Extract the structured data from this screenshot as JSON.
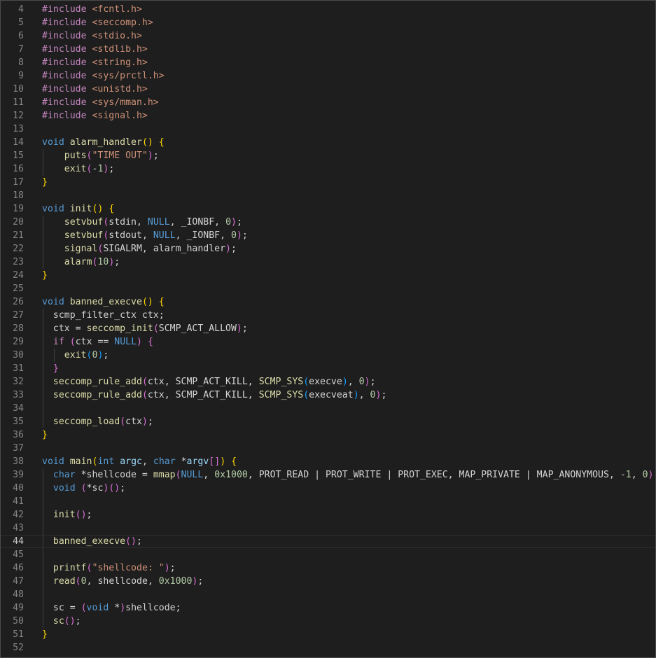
{
  "editor": {
    "language": "c",
    "lines": [
      {
        "n": "4",
        "indent": [],
        "tokens": [
          [
            "#include ",
            "pp"
          ],
          [
            "<fcntl.h>",
            "str"
          ]
        ]
      },
      {
        "n": "5",
        "indent": [],
        "tokens": [
          [
            "#include ",
            "pp"
          ],
          [
            "<seccomp.h>",
            "str"
          ]
        ]
      },
      {
        "n": "6",
        "indent": [],
        "tokens": [
          [
            "#include ",
            "pp"
          ],
          [
            "<stdio.h>",
            "str"
          ]
        ]
      },
      {
        "n": "7",
        "indent": [],
        "tokens": [
          [
            "#include ",
            "pp"
          ],
          [
            "<stdlib.h>",
            "str"
          ]
        ]
      },
      {
        "n": "8",
        "indent": [],
        "tokens": [
          [
            "#include ",
            "pp"
          ],
          [
            "<string.h>",
            "str"
          ]
        ]
      },
      {
        "n": "9",
        "indent": [],
        "tokens": [
          [
            "#include ",
            "pp"
          ],
          [
            "<sys/prctl.h>",
            "str"
          ]
        ]
      },
      {
        "n": "10",
        "indent": [],
        "tokens": [
          [
            "#include ",
            "pp"
          ],
          [
            "<unistd.h>",
            "str"
          ]
        ]
      },
      {
        "n": "11",
        "indent": [],
        "tokens": [
          [
            "#include ",
            "pp"
          ],
          [
            "<sys/mman.h>",
            "str"
          ]
        ]
      },
      {
        "n": "12",
        "indent": [],
        "tokens": [
          [
            "#include ",
            "pp"
          ],
          [
            "<signal.h>",
            "str"
          ]
        ]
      },
      {
        "n": "13",
        "indent": [],
        "tokens": []
      },
      {
        "n": "14",
        "indent": [],
        "tokens": [
          [
            "void",
            "kw"
          ],
          [
            " ",
            "def"
          ],
          [
            "alarm_handler",
            "fn"
          ],
          [
            "()",
            "b1"
          ],
          [
            " ",
            "def"
          ],
          [
            "{",
            "b1"
          ]
        ]
      },
      {
        "n": "15",
        "indent": [
          0
        ],
        "tokens": [
          [
            "    ",
            "def"
          ],
          [
            "puts",
            "fn"
          ],
          [
            "(",
            "b2"
          ],
          [
            "\"TIME OUT\"",
            "str"
          ],
          [
            ")",
            "b2"
          ],
          [
            ";",
            "def"
          ]
        ]
      },
      {
        "n": "16",
        "indent": [
          0
        ],
        "tokens": [
          [
            "    ",
            "def"
          ],
          [
            "exit",
            "fn"
          ],
          [
            "(",
            "b2"
          ],
          [
            "-",
            "def"
          ],
          [
            "1",
            "num"
          ],
          [
            ")",
            "b2"
          ],
          [
            ";",
            "def"
          ]
        ]
      },
      {
        "n": "17",
        "indent": [],
        "tokens": [
          [
            "}",
            "b1"
          ]
        ]
      },
      {
        "n": "18",
        "indent": [],
        "tokens": []
      },
      {
        "n": "19",
        "indent": [],
        "tokens": [
          [
            "void",
            "kw"
          ],
          [
            " ",
            "def"
          ],
          [
            "init",
            "fn"
          ],
          [
            "()",
            "b1"
          ],
          [
            " ",
            "def"
          ],
          [
            "{",
            "b1"
          ]
        ]
      },
      {
        "n": "20",
        "indent": [
          0
        ],
        "tokens": [
          [
            "    ",
            "def"
          ],
          [
            "setvbuf",
            "fn"
          ],
          [
            "(",
            "b2"
          ],
          [
            "stdin",
            "def"
          ],
          [
            ", ",
            "def"
          ],
          [
            "NULL",
            "const"
          ],
          [
            ", _IONBF, ",
            "def"
          ],
          [
            "0",
            "num"
          ],
          [
            ")",
            "b2"
          ],
          [
            ";",
            "def"
          ]
        ]
      },
      {
        "n": "21",
        "indent": [
          0
        ],
        "tokens": [
          [
            "    ",
            "def"
          ],
          [
            "setvbuf",
            "fn"
          ],
          [
            "(",
            "b2"
          ],
          [
            "stdout",
            "def"
          ],
          [
            ", ",
            "def"
          ],
          [
            "NULL",
            "const"
          ],
          [
            ", _IONBF, ",
            "def"
          ],
          [
            "0",
            "num"
          ],
          [
            ")",
            "b2"
          ],
          [
            ";",
            "def"
          ]
        ]
      },
      {
        "n": "22",
        "indent": [
          0
        ],
        "tokens": [
          [
            "    ",
            "def"
          ],
          [
            "signal",
            "fn"
          ],
          [
            "(",
            "b2"
          ],
          [
            "SIGALRM, alarm_handler",
            "def"
          ],
          [
            ")",
            "b2"
          ],
          [
            ";",
            "def"
          ]
        ]
      },
      {
        "n": "23",
        "indent": [
          0
        ],
        "tokens": [
          [
            "    ",
            "def"
          ],
          [
            "alarm",
            "fn"
          ],
          [
            "(",
            "b2"
          ],
          [
            "10",
            "num"
          ],
          [
            ")",
            "b2"
          ],
          [
            ";",
            "def"
          ]
        ]
      },
      {
        "n": "24",
        "indent": [],
        "tokens": [
          [
            "}",
            "b1"
          ]
        ]
      },
      {
        "n": "25",
        "indent": [],
        "tokens": []
      },
      {
        "n": "26",
        "indent": [],
        "tokens": [
          [
            "void",
            "kw"
          ],
          [
            " ",
            "def"
          ],
          [
            "banned_execve",
            "fn"
          ],
          [
            "()",
            "b1"
          ],
          [
            " ",
            "def"
          ],
          [
            "{",
            "b1"
          ]
        ]
      },
      {
        "n": "27",
        "indent": [
          0
        ],
        "tokens": [
          [
            "  ",
            "def"
          ],
          [
            "scmp_filter_ctx ctx",
            "def"
          ],
          [
            ";",
            "def"
          ]
        ]
      },
      {
        "n": "28",
        "indent": [
          0
        ],
        "tokens": [
          [
            "  ctx = ",
            "def"
          ],
          [
            "seccomp_init",
            "fn"
          ],
          [
            "(",
            "b2"
          ],
          [
            "SCMP_ACT_ALLOW",
            "def"
          ],
          [
            ")",
            "b2"
          ],
          [
            ";",
            "def"
          ]
        ]
      },
      {
        "n": "29",
        "indent": [
          0
        ],
        "tokens": [
          [
            "  ",
            "def"
          ],
          [
            "if",
            "ctl"
          ],
          [
            " ",
            "def"
          ],
          [
            "(",
            "b2"
          ],
          [
            "ctx == ",
            "def"
          ],
          [
            "NULL",
            "const"
          ],
          [
            ")",
            "b2"
          ],
          [
            " ",
            "def"
          ],
          [
            "{",
            "b2"
          ]
        ]
      },
      {
        "n": "30",
        "indent": [
          0,
          1
        ],
        "tokens": [
          [
            "    ",
            "def"
          ],
          [
            "exit",
            "fn"
          ],
          [
            "(",
            "b3"
          ],
          [
            "0",
            "num"
          ],
          [
            ")",
            "b3"
          ],
          [
            ";",
            "def"
          ]
        ]
      },
      {
        "n": "31",
        "indent": [
          0
        ],
        "tokens": [
          [
            "  ",
            "def"
          ],
          [
            "}",
            "b2"
          ]
        ]
      },
      {
        "n": "32",
        "indent": [
          0
        ],
        "tokens": [
          [
            "  ",
            "def"
          ],
          [
            "seccomp_rule_add",
            "fn"
          ],
          [
            "(",
            "b2"
          ],
          [
            "ctx, SCMP_ACT_KILL, ",
            "def"
          ],
          [
            "SCMP_SYS",
            "fn"
          ],
          [
            "(",
            "b3"
          ],
          [
            "execve",
            "def"
          ],
          [
            ")",
            "b3"
          ],
          [
            ", ",
            "def"
          ],
          [
            "0",
            "num"
          ],
          [
            ")",
            "b2"
          ],
          [
            ";",
            "def"
          ]
        ]
      },
      {
        "n": "33",
        "indent": [
          0
        ],
        "tokens": [
          [
            "  ",
            "def"
          ],
          [
            "seccomp_rule_add",
            "fn"
          ],
          [
            "(",
            "b2"
          ],
          [
            "ctx, SCMP_ACT_KILL, ",
            "def"
          ],
          [
            "SCMP_SYS",
            "fn"
          ],
          [
            "(",
            "b3"
          ],
          [
            "execveat",
            "def"
          ],
          [
            ")",
            "b3"
          ],
          [
            ", ",
            "def"
          ],
          [
            "0",
            "num"
          ],
          [
            ")",
            "b2"
          ],
          [
            ";",
            "def"
          ]
        ]
      },
      {
        "n": "34",
        "indent": [
          0
        ],
        "tokens": []
      },
      {
        "n": "35",
        "indent": [
          0
        ],
        "tokens": [
          [
            "  ",
            "def"
          ],
          [
            "seccomp_load",
            "fn"
          ],
          [
            "(",
            "b2"
          ],
          [
            "ctx",
            "def"
          ],
          [
            ")",
            "b2"
          ],
          [
            ";",
            "def"
          ]
        ]
      },
      {
        "n": "36",
        "indent": [],
        "tokens": [
          [
            "}",
            "b1"
          ]
        ]
      },
      {
        "n": "37",
        "indent": [],
        "tokens": []
      },
      {
        "n": "38",
        "indent": [],
        "tokens": [
          [
            "void",
            "kw"
          ],
          [
            " ",
            "def"
          ],
          [
            "main",
            "fn"
          ],
          [
            "(",
            "b1"
          ],
          [
            "int",
            "kw"
          ],
          [
            " ",
            "def"
          ],
          [
            "argc",
            "var"
          ],
          [
            ", ",
            "def"
          ],
          [
            "char",
            "kw"
          ],
          [
            " *",
            "def"
          ],
          [
            "argv",
            "var"
          ],
          [
            "[]",
            "b2"
          ],
          [
            ")",
            "b1"
          ],
          [
            " ",
            "def"
          ],
          [
            "{",
            "b1"
          ]
        ]
      },
      {
        "n": "39",
        "indent": [
          0
        ],
        "tokens": [
          [
            "  ",
            "def"
          ],
          [
            "char",
            "kw"
          ],
          [
            " *shellcode = ",
            "def"
          ],
          [
            "mmap",
            "fn"
          ],
          [
            "(",
            "b2"
          ],
          [
            "NULL",
            "const"
          ],
          [
            ", ",
            "def"
          ],
          [
            "0x1000",
            "num"
          ],
          [
            ", PROT_READ | PROT_WRITE | PROT_EXEC, MAP_PRIVATE | MAP_ANONYMOUS, ",
            "def"
          ],
          [
            "-",
            "def"
          ],
          [
            "1",
            "num"
          ],
          [
            ", ",
            "def"
          ],
          [
            "0",
            "num"
          ],
          [
            ")",
            "b2"
          ],
          [
            ";",
            "def"
          ]
        ]
      },
      {
        "n": "40",
        "indent": [
          0
        ],
        "tokens": [
          [
            "  ",
            "def"
          ],
          [
            "void",
            "kw"
          ],
          [
            " ",
            "def"
          ],
          [
            "(",
            "b2"
          ],
          [
            "*sc",
            "def"
          ],
          [
            ")",
            "b2"
          ],
          [
            "()",
            "b2"
          ],
          [
            ";",
            "def"
          ]
        ]
      },
      {
        "n": "41",
        "indent": [
          0
        ],
        "tokens": []
      },
      {
        "n": "42",
        "indent": [
          0
        ],
        "tokens": [
          [
            "  ",
            "def"
          ],
          [
            "init",
            "fn"
          ],
          [
            "()",
            "b2"
          ],
          [
            ";",
            "def"
          ]
        ]
      },
      {
        "n": "43",
        "indent": [
          0
        ],
        "tokens": []
      },
      {
        "n": "44",
        "indent": [
          0
        ],
        "current": true,
        "tokens": [
          [
            "  ",
            "def"
          ],
          [
            "banned_execve",
            "fn"
          ],
          [
            "()",
            "b2"
          ],
          [
            ";",
            "def"
          ]
        ]
      },
      {
        "n": "45",
        "indent": [
          0
        ],
        "tokens": []
      },
      {
        "n": "46",
        "indent": [
          0
        ],
        "tokens": [
          [
            "  ",
            "def"
          ],
          [
            "printf",
            "fn"
          ],
          [
            "(",
            "b2"
          ],
          [
            "\"shellcode: \"",
            "str"
          ],
          [
            ")",
            "b2"
          ],
          [
            ";",
            "def"
          ]
        ]
      },
      {
        "n": "47",
        "indent": [
          0
        ],
        "tokens": [
          [
            "  ",
            "def"
          ],
          [
            "read",
            "fn"
          ],
          [
            "(",
            "b2"
          ],
          [
            "0",
            "num"
          ],
          [
            ", shellcode, ",
            "def"
          ],
          [
            "0x1000",
            "num"
          ],
          [
            ")",
            "b2"
          ],
          [
            ";",
            "def"
          ]
        ]
      },
      {
        "n": "48",
        "indent": [
          0
        ],
        "tokens": []
      },
      {
        "n": "49",
        "indent": [
          0
        ],
        "tokens": [
          [
            "  sc = ",
            "def"
          ],
          [
            "(",
            "b2"
          ],
          [
            "void",
            "kw"
          ],
          [
            " *",
            "def"
          ],
          [
            ")",
            "b2"
          ],
          [
            "shellcode",
            "def"
          ],
          [
            ";",
            "def"
          ]
        ]
      },
      {
        "n": "50",
        "indent": [
          0
        ],
        "tokens": [
          [
            "  ",
            "def"
          ],
          [
            "sc",
            "fn"
          ],
          [
            "()",
            "b2"
          ],
          [
            ";",
            "def"
          ]
        ]
      },
      {
        "n": "51",
        "indent": [],
        "tokens": [
          [
            "}",
            "b1"
          ]
        ]
      },
      {
        "n": "52",
        "indent": [],
        "tokens": []
      }
    ]
  },
  "colors": {
    "background": "#1e1e1e",
    "line_number": "#858585",
    "keyword": "#569cd6",
    "preprocessor": "#c586c0",
    "string": "#ce9178",
    "function": "#dcdcaa",
    "number": "#b5cea8",
    "text": "#d4d4d4"
  }
}
